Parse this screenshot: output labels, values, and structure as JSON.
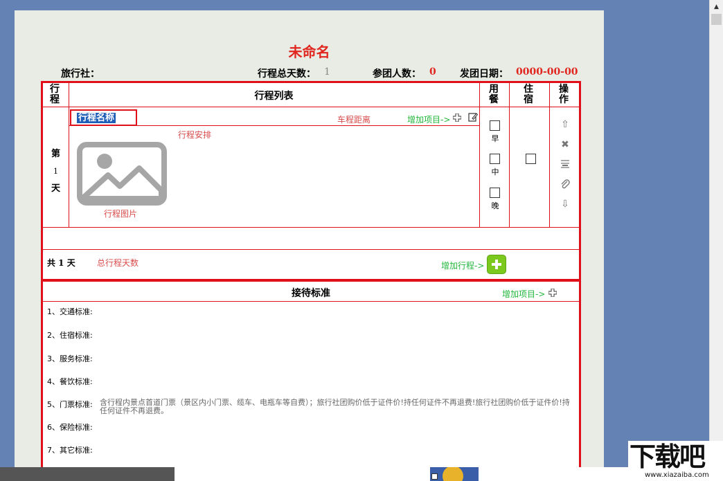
{
  "document": {
    "title": "未命名",
    "agency_label": "旅行社：",
    "total_days_label": "行程总天数：",
    "total_days_value": "1",
    "people_label": "参团人数：",
    "people_value": "0",
    "date_label": "发团日期：",
    "date_value": "0000-00-00"
  },
  "itinerary": {
    "col_trip": "行程",
    "col_list": "行程列表",
    "col_meal": "用餐",
    "col_lodging": "住宿",
    "col_ops": "操作",
    "day": {
      "prefix": "第",
      "number": "1",
      "suffix": "天"
    },
    "name_placeholder": "行程名称",
    "distance_label": "车程距离",
    "add_item_label": "增加项目->",
    "arrangement_label": "行程安排",
    "image_label": "行程图片",
    "meals": [
      "早",
      "中",
      "晚"
    ],
    "footer_total": "共 1 天",
    "footer_total_hint": "总行程天数",
    "add_trip_label": "增加行程->"
  },
  "reception": {
    "title": "接待标准",
    "add_item_label": "增加项目->",
    "items": [
      {
        "label": "1、交通标准:",
        "value": ""
      },
      {
        "label": "2、住宿标准:",
        "value": ""
      },
      {
        "label": "3、服务标准:",
        "value": ""
      },
      {
        "label": "4、餐饮标准:",
        "value": ""
      },
      {
        "label": "5、门票标准:",
        "value": "含行程内景点首道门票（景区内小门票、缆车、电瓶车等自费）；旅行社团购价低于证件价!持任何证件不再退费!旅行社团购价低于证件价!持任何证件不再退费。"
      },
      {
        "label": "6、保险标准:",
        "value": ""
      },
      {
        "label": "7、其它标准:",
        "value": ""
      }
    ]
  },
  "watermark": {
    "logo_text": "下载吧",
    "url": "www.xiazaiba.com"
  },
  "colors": {
    "red": "#e0101a",
    "green": "#22b73c",
    "hint": "#d94c4c",
    "page_bg": "#e8ece4",
    "desktop": "#6483b4"
  }
}
